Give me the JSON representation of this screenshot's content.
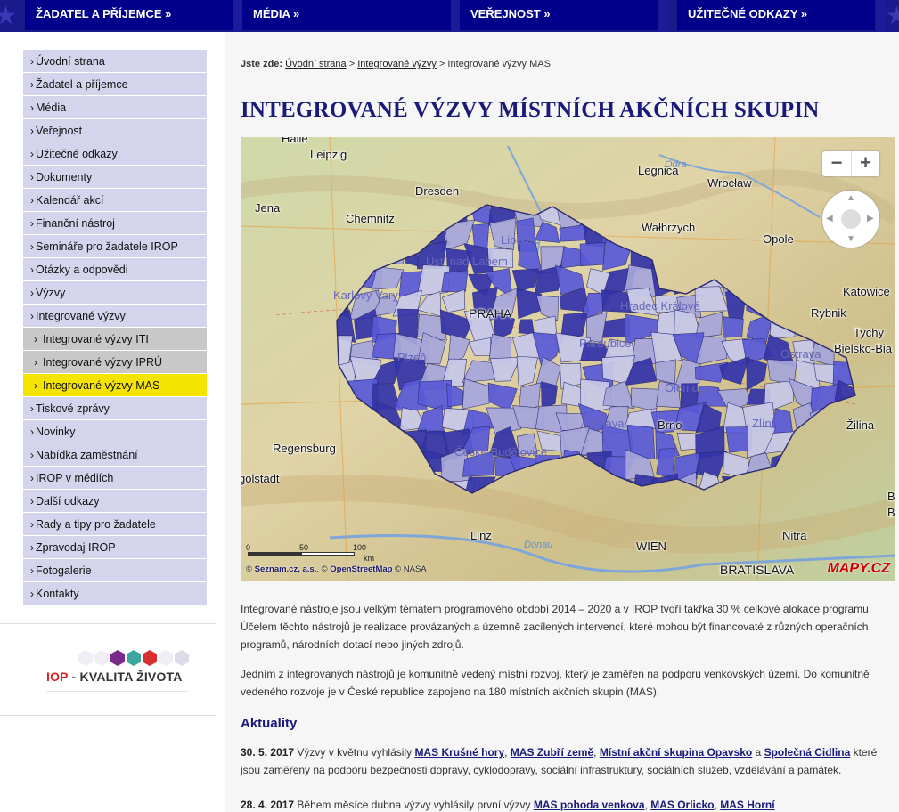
{
  "topnav": {
    "tabs": [
      {
        "label": "ŽADATEL A PŘÍJEMCE »"
      },
      {
        "label": "MÉDIA »"
      },
      {
        "label": "VEŘEJNOST »"
      },
      {
        "label": "UŽITEČNÉ ODKAZY »"
      }
    ]
  },
  "sidebar": {
    "items": [
      {
        "label": "Úvodní strana"
      },
      {
        "label": "Žadatel a příjemce"
      },
      {
        "label": "Média"
      },
      {
        "label": "Veřejnost"
      },
      {
        "label": "Užitečné odkazy"
      },
      {
        "label": "Dokumenty"
      },
      {
        "label": "Kalendář akcí"
      },
      {
        "label": "Finanční nástroj"
      },
      {
        "label": "Semináře pro žadatele IROP"
      },
      {
        "label": "Otázky a odpovědi"
      },
      {
        "label": "Výzvy"
      },
      {
        "label": "Integrované výzvy"
      },
      {
        "label": "Integrované výzvy ITI"
      },
      {
        "label": "Integrované výzvy IPRÚ"
      },
      {
        "label": "Integrované výzvy MAS"
      },
      {
        "label": "Tiskové zprávy"
      },
      {
        "label": "Novinky"
      },
      {
        "label": "Nabídka zaměstnání"
      },
      {
        "label": "IROP v médiích"
      },
      {
        "label": "Další odkazy"
      },
      {
        "label": "Rady a tipy pro žadatele"
      },
      {
        "label": "Zpravodaj IROP"
      },
      {
        "label": "Fotogalerie"
      },
      {
        "label": "Kontakty"
      }
    ],
    "caret": "›"
  },
  "logo": {
    "iop": "IOP",
    "dash": " - ",
    "name": "KVALITA ŽIVOTA",
    "hex_colors": [
      "#eeeef4",
      "#eeeef4",
      "#7a2a8a",
      "#3aa6a0",
      "#d83030",
      "#eeeef4",
      "#dcdce8"
    ]
  },
  "breadcrumb": {
    "label": "Jste zde:",
    "home": "Úvodní strana",
    "sep": ">",
    "parent": "Integrované výzvy",
    "current": "Integrované výzvy MAS"
  },
  "page": {
    "title": "INTEGROVANÉ VÝZVY MÍSTNÍCH AKČNÍCH SKUPIN"
  },
  "map": {
    "cities": [
      {
        "name": "Halle"
      },
      {
        "name": "Leipzig"
      },
      {
        "name": "Dresden"
      },
      {
        "name": "Legnica"
      },
      {
        "name": "Wrocław"
      },
      {
        "name": "Jena"
      },
      {
        "name": "Chemnitz"
      },
      {
        "name": "Wałbrzych"
      },
      {
        "name": "Opole"
      },
      {
        "name": "Liberec"
      },
      {
        "name": "Ústí nad Labem"
      },
      {
        "name": "Katowice"
      },
      {
        "name": "Karlovy Vary"
      },
      {
        "name": "Hradec Králové"
      },
      {
        "name": "PRAHA"
      },
      {
        "name": "Rybnik"
      },
      {
        "name": "Tychy"
      },
      {
        "name": "Pardubice"
      },
      {
        "name": "Bielsko-Bia"
      },
      {
        "name": "Plzeň"
      },
      {
        "name": "Ostrava"
      },
      {
        "name": "Olomouc"
      },
      {
        "name": "Jihlava"
      },
      {
        "name": "Brno"
      },
      {
        "name": "Zlín"
      },
      {
        "name": "Žilina"
      },
      {
        "name": "Regensburg"
      },
      {
        "name": "České Budějovice"
      },
      {
        "name": "golstadt"
      },
      {
        "name": "Linz"
      },
      {
        "name": "Nitra"
      },
      {
        "name": "WIEN"
      },
      {
        "name": "BRATISLAVA"
      },
      {
        "name": "B"
      },
      {
        "name": "By"
      }
    ],
    "rivers": [
      {
        "name": "Odra"
      },
      {
        "name": "Donau"
      }
    ],
    "zoom_out": "−",
    "zoom_in": "+",
    "scale_labels": [
      "0",
      "50",
      "100"
    ],
    "scale_unit": "km",
    "copyright_prefix": "© ",
    "copyright_seznam": "Seznam.cz, a.s.",
    "copyright_osm_prefix": ", © ",
    "copyright_osm": "OpenStreetMap",
    "copyright_nasa": " © NASA",
    "brand": "MAPY.CZ",
    "colors": {
      "dark": "#3333aa",
      "mid": "#5a5ad8",
      "light": "#a6a6dc",
      "pale": "#c8c8ea",
      "terrain": "#d9cfa8"
    }
  },
  "content": {
    "para1": "Integrované nástroje jsou velkým tématem programového období 2014 – 2020 a v IROP tvoří takřka 30 % celkové alokace programu. Účelem těchto nástrojů je realizace provázaných a územně zacílených intervencí, které mohou být financovaté z různých operačních programů, národních dotací nebo jiných zdrojů.",
    "para2": "Jedním z integrovaných nástrojů je komunitně vedený místní rozvoj, který je zaměřen na podporu venkovských území. Do komunitně vedeného rozvoje je v České republice zapojeno na 180 místních akčních skupin (MAS).",
    "news_heading": "Aktuality",
    "news1": {
      "date": "30. 5. 2017",
      "text1": " Výzvy v květnu vyhlásily ",
      "link1": "MAS Krušné hory",
      "sep1": ", ",
      "link2": "MAS Zubří země",
      "sep2": ", ",
      "link3": "Místní akční skupina Opavsko",
      "sep3": " a ",
      "link4": "Společná Cidlina",
      "text2": "  které jsou zaměřeny na podporu bezpečnosti dopravy, cyklodopravy, sociální infrastruktury, sociálních služeb, vzdělávání a památek."
    },
    "news2": {
      "date": "28. 4. 2017",
      "text1": " Během měsíce dubna výzvy vyhlásily první výzvy ",
      "link1": "MAS pohoda venkova",
      "sep1": ", ",
      "link2": "MAS Orlicko",
      "sep2": ", ",
      "link3": "MAS Horní"
    }
  }
}
